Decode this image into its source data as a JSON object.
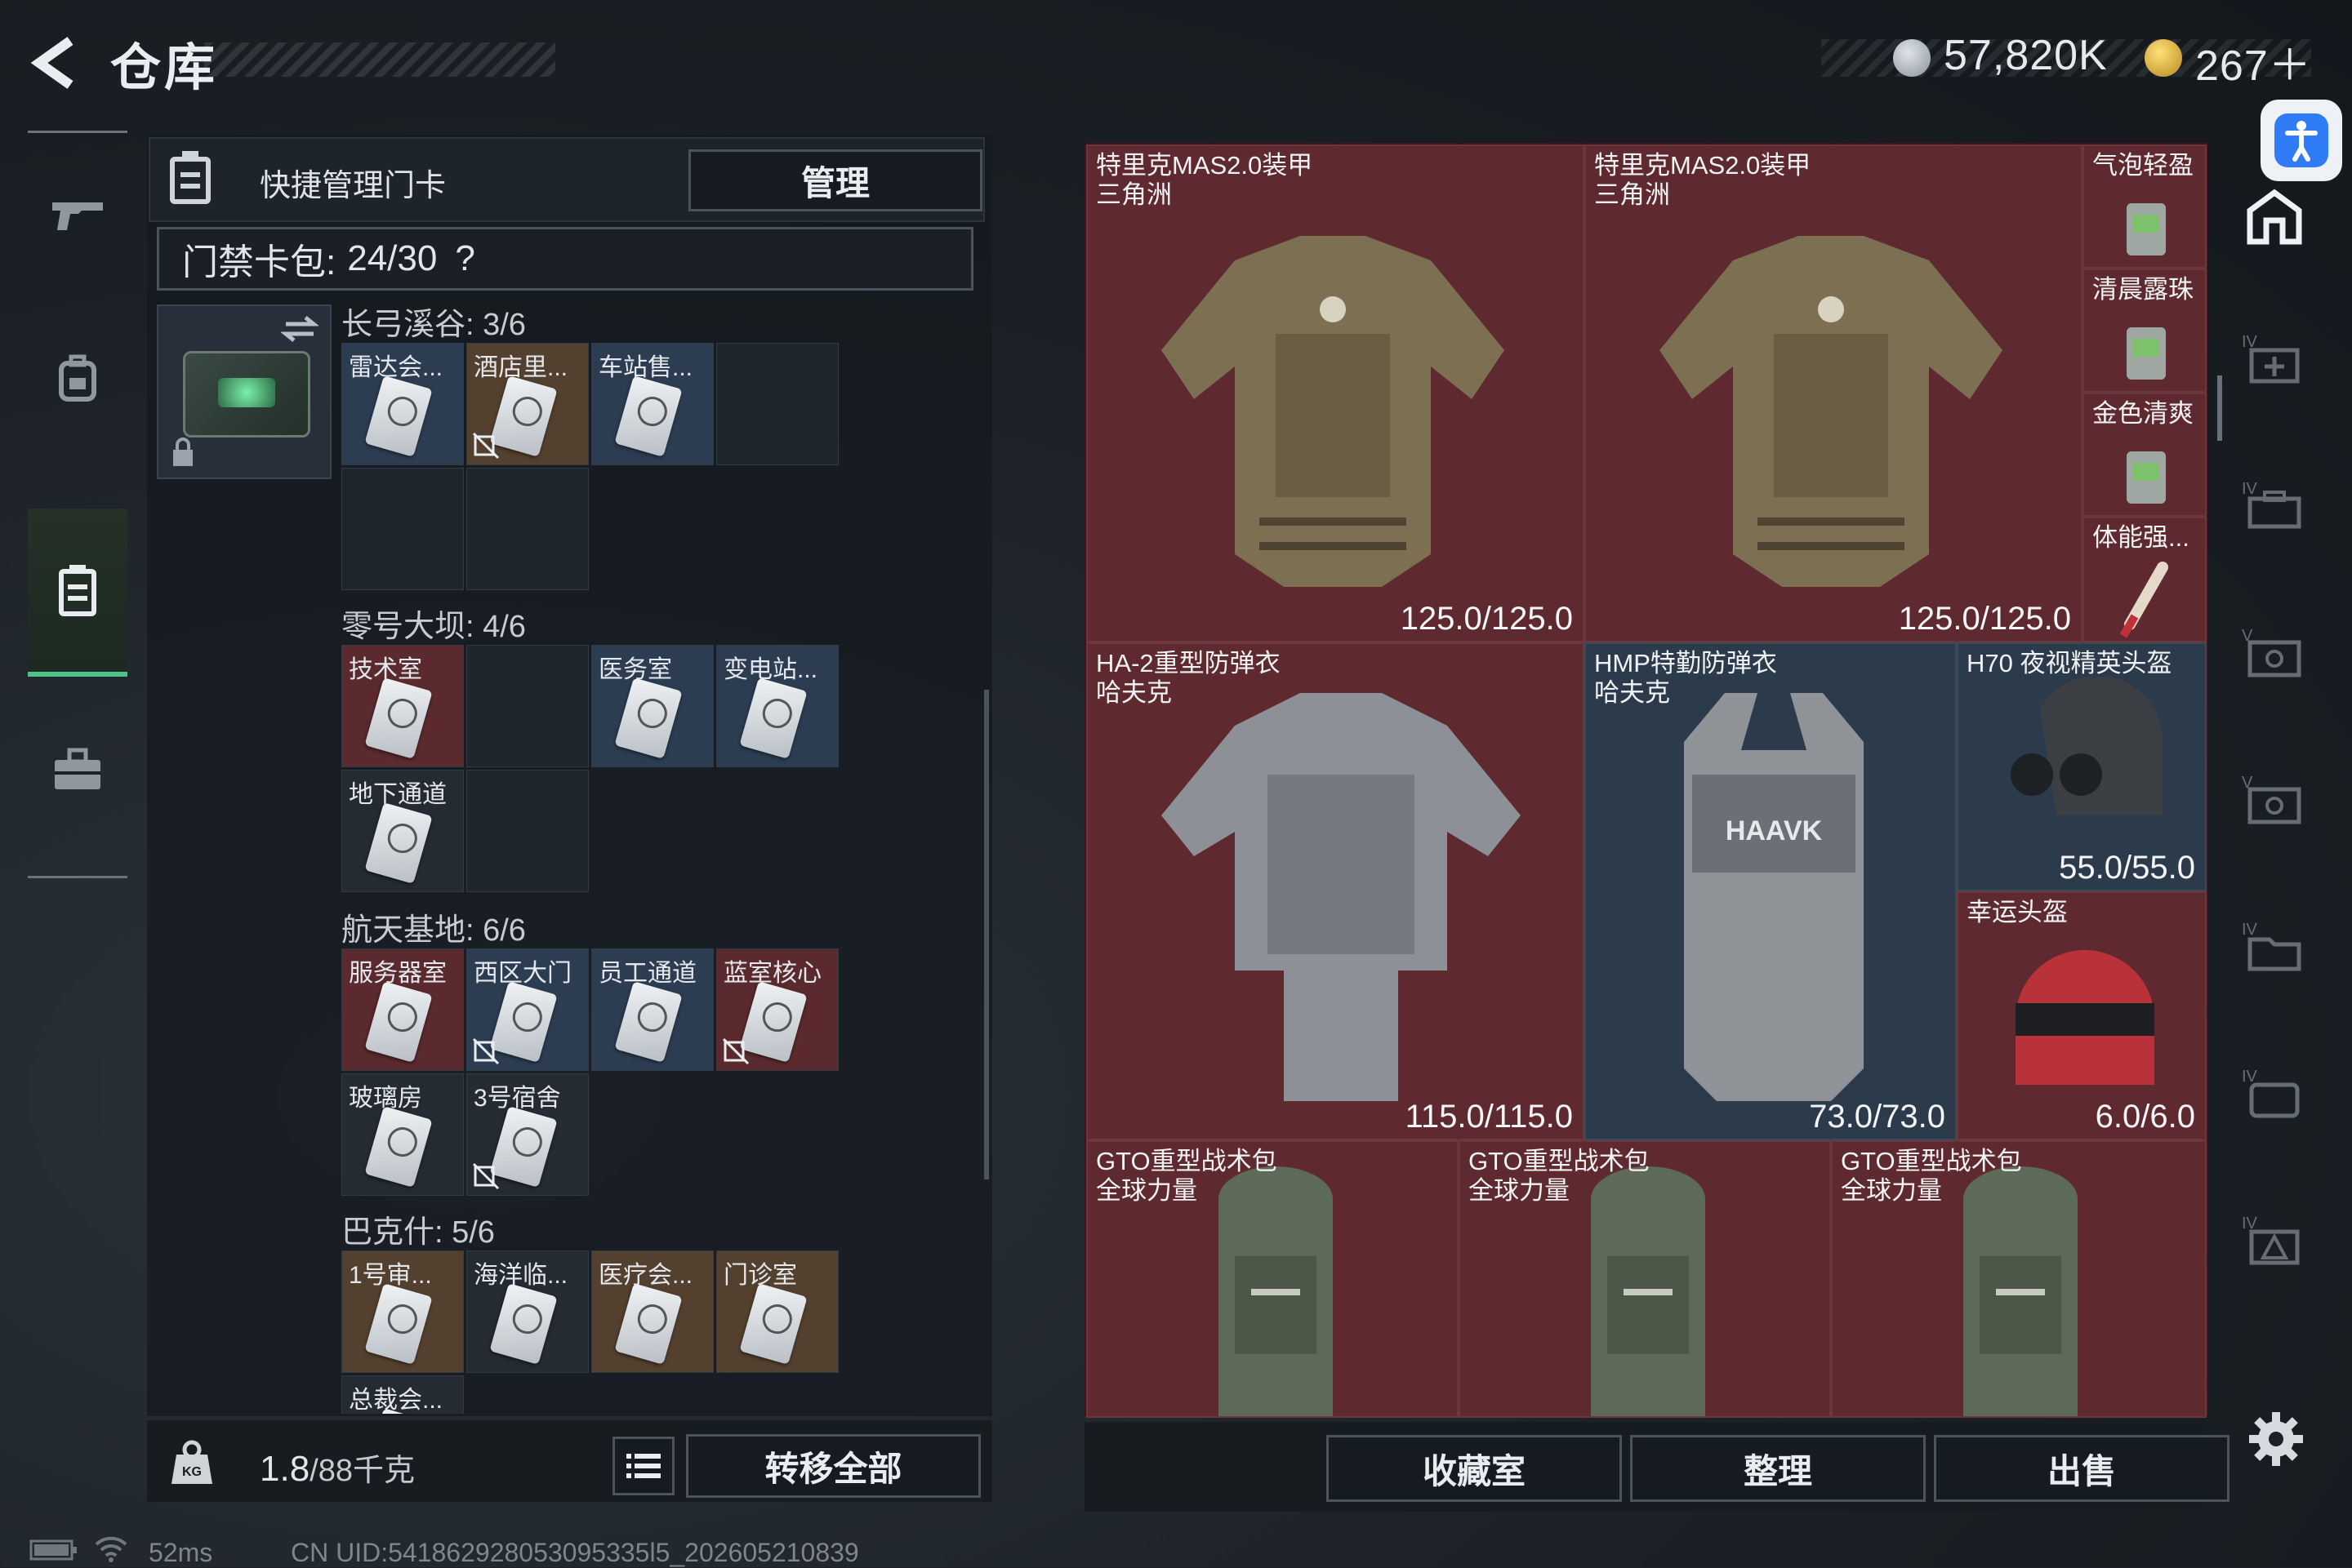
{
  "header": {
    "title": "仓库",
    "currency1": "57,820K",
    "currency2": "267＋"
  },
  "quick_manage": {
    "label": "快捷管理门卡",
    "manage_button": "管理"
  },
  "card_pack": {
    "label": "门禁卡包:",
    "count": "24/30",
    "help": "?"
  },
  "sections": [
    {
      "title": "长弓溪谷: 3/6",
      "cells": [
        {
          "label": "雷达会...",
          "tone": "blue",
          "card": true,
          "nolink": false
        },
        {
          "label": "酒店里...",
          "tone": "brown",
          "card": true,
          "nolink": true
        },
        {
          "label": "车站售...",
          "tone": "blue",
          "card": true,
          "nolink": false
        },
        {
          "label": "",
          "tone": "empty",
          "card": false,
          "nolink": false
        },
        {
          "label": "",
          "tone": "empty",
          "card": false,
          "nolink": false
        },
        {
          "label": "",
          "tone": "empty",
          "card": false,
          "nolink": false
        }
      ]
    },
    {
      "title": "零号大坝: 4/6",
      "cells": [
        {
          "label": "技术室",
          "tone": "red",
          "card": true,
          "nolink": false
        },
        {
          "label": "",
          "tone": "empty",
          "card": false,
          "nolink": false
        },
        {
          "label": "医务室",
          "tone": "blue",
          "card": true,
          "nolink": false
        },
        {
          "label": "变电站...",
          "tone": "blue",
          "card": true,
          "nolink": false
        },
        {
          "label": "地下通道",
          "tone": "default",
          "card": true,
          "nolink": false
        },
        {
          "label": "",
          "tone": "empty",
          "card": false,
          "nolink": false
        }
      ]
    },
    {
      "title": "航天基地: 6/6",
      "cells": [
        {
          "label": "服务器室",
          "tone": "red",
          "card": true,
          "nolink": false
        },
        {
          "label": "西区大门",
          "tone": "blue",
          "card": true,
          "nolink": true
        },
        {
          "label": "员工通道",
          "tone": "blue",
          "card": true,
          "nolink": false
        },
        {
          "label": "蓝室核心",
          "tone": "red",
          "card": true,
          "nolink": true
        },
        {
          "label": "玻璃房",
          "tone": "default",
          "card": true,
          "nolink": false
        },
        {
          "label": "3号宿舍",
          "tone": "default",
          "card": true,
          "nolink": true
        }
      ]
    },
    {
      "title": "巴克什: 5/6",
      "cells": [
        {
          "label": "1号审...",
          "tone": "brown",
          "card": true,
          "nolink": false
        },
        {
          "label": "海洋临...",
          "tone": "default",
          "card": true,
          "nolink": false
        },
        {
          "label": "医疗会...",
          "tone": "brown",
          "card": true,
          "nolink": false
        },
        {
          "label": "门诊室",
          "tone": "brown",
          "card": true,
          "nolink": false
        },
        {
          "label": "总裁会...",
          "tone": "default",
          "card": true,
          "nolink": false
        }
      ]
    }
  ],
  "footer_left": {
    "weight": "1.8",
    "weight_unit": "/88千克",
    "transfer_all": "转移全部"
  },
  "stash_items": [
    {
      "id": "armor1",
      "name": "特里克MAS2.0装甲",
      "sub": "三角洲",
      "durability": "125.0/125.0",
      "kind": "armor"
    },
    {
      "id": "armor2",
      "name": "特里克MAS2.0装甲",
      "sub": "三角洲",
      "durability": "125.0/125.0",
      "kind": "armor"
    },
    {
      "id": "c1",
      "name": "气泡轻盈",
      "sub": "",
      "durability": "",
      "kind": "drink"
    },
    {
      "id": "c2",
      "name": "清晨露珠",
      "sub": "",
      "durability": "",
      "kind": "drink"
    },
    {
      "id": "c3",
      "name": "金色清爽",
      "sub": "",
      "durability": "",
      "kind": "drink"
    },
    {
      "id": "c4",
      "name": "体能强...",
      "sub": "",
      "durability": "",
      "kind": "syringe"
    },
    {
      "id": "vest1",
      "name": "HA-2重型防弹衣",
      "sub": "哈夫克",
      "durability": "115.0/115.0",
      "kind": "vest-grey"
    },
    {
      "id": "vest2",
      "name": "HMP特勤防弹衣",
      "sub": "哈夫克",
      "durability": "73.0/73.0",
      "kind": "vest-plate"
    },
    {
      "id": "helm1",
      "name": "H70 夜视精英头盔",
      "sub": "",
      "durability": "55.0/55.0",
      "kind": "helmet-nv"
    },
    {
      "id": "helm2",
      "name": "幸运头盔",
      "sub": "",
      "durability": "6.0/6.0",
      "kind": "helmet-red"
    },
    {
      "id": "bag1",
      "name": "GTO重型战术包",
      "sub": "全球力量",
      "durability": "",
      "kind": "bag"
    },
    {
      "id": "bag2",
      "name": "GTO重型战术包",
      "sub": "全球力量",
      "durability": "",
      "kind": "bag"
    },
    {
      "id": "bag3",
      "name": "GTO重型战术包",
      "sub": "全球力量",
      "durability": "",
      "kind": "bag"
    }
  ],
  "bottom_buttons": {
    "collection": "收藏室",
    "sort": "整理",
    "sell": "出售"
  },
  "status_bar": {
    "ping": "52ms",
    "uid": "CN UID:541862928053095335l5_202605210839"
  },
  "colors": {
    "accent_green": "#4fc38a",
    "item_red": "#5e2a2f",
    "item_blue": "#2c3b4c"
  }
}
